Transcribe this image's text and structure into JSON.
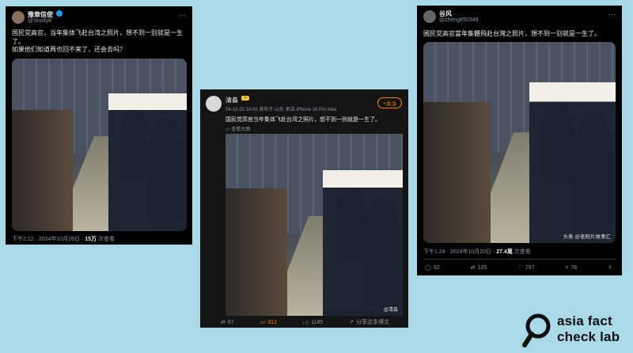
{
  "card1": {
    "name": "豫章信使",
    "handle": "@Snolly8",
    "text1": "国民党高官，当年集体飞赴台湾之照片，想不到一别就是一生了。",
    "text2": "如果他们知道再也回不来了，还会去吗？",
    "time": "下午2:12 · 2024年10月26日 · ",
    "views_num": "15万",
    "views_label": " 次查看"
  },
  "card2": {
    "name": "清淼",
    "badge": "V",
    "meta": "24-10-20 18:00 发布于 山东 来自 iPhone 16 Pro Max",
    "follow": "+关注",
    "text": "国民党高官当年集体飞赴台湾之照片，想不到一别就是一生了。",
    "translate": "查看大图",
    "watermark": "@清淼",
    "repost": "67",
    "comment": "312",
    "like": "1145",
    "share": "分享这条博文"
  },
  "card3": {
    "name": "谷风",
    "handle": "@zheng850349",
    "text": "國民党高官當年集體飛赴台灣之照片，想不到一别就是一生了。",
    "watermark": "头条 @老照片故事汇",
    "time": "下午1:24 · 2024年10月20日 · ",
    "views_num": "27.4萬",
    "views_label": " 次查看",
    "replies": "92",
    "retweets": "105",
    "likes": "797",
    "bookmarks": "78"
  },
  "logo": {
    "line1": "asia fact",
    "line2": "check lab"
  },
  "colors": {
    "background": "#a9d8e6",
    "card": "#000000",
    "weibo_orange": "#ff8200"
  }
}
